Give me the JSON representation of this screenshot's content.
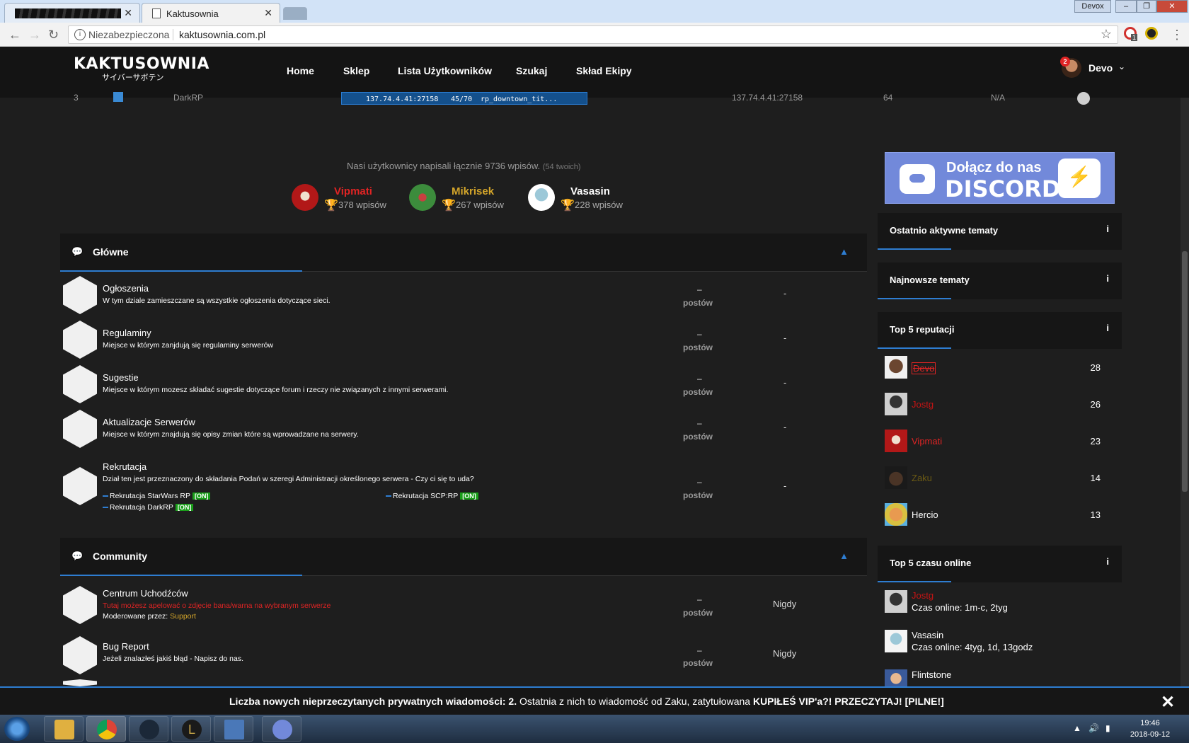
{
  "browser": {
    "tabs": [
      {
        "title": ""
      },
      {
        "title": "Kaktusownia"
      }
    ],
    "window_user": "Devox",
    "address": {
      "insecure_label": "Niezabezpieczona",
      "url": "kaktusownia.com.pl"
    },
    "ext_badge": "1"
  },
  "site": {
    "logo": {
      "name": "KAKTUSOWNIA",
      "sub": "サイバーサボテン"
    },
    "nav": [
      "Home",
      "Sklep",
      "Lista Użytkowników",
      "Szukaj",
      "Skład Ekipy"
    ],
    "user": {
      "name": "Devo",
      "notifications": "2"
    }
  },
  "server_row": {
    "rank": "3",
    "name": "DarkRP",
    "banner_address": "137.74.4.41:27158",
    "banner_players": "45/70",
    "banner_map": "rp_downtown_tit...",
    "address": "137.74.4.41:27158",
    "slots": "64",
    "status": "N/A"
  },
  "stats": {
    "line": "Nasi użytkownicy napisali łącznie 9736 wpisów.",
    "own": "(54 twoich)",
    "top_posters": [
      {
        "name": "Vipmati",
        "count": "378 wpisów",
        "color": "#e02424",
        "trophy_color": "#e0b020"
      },
      {
        "name": "Mikrisek",
        "count": "267 wpisów",
        "color": "#d4a52a",
        "trophy_color": "#bbbbbb"
      },
      {
        "name": "Vasasin",
        "count": "228 wpisów",
        "color": "#ffffff",
        "trophy_color": "#b0301c"
      }
    ]
  },
  "sections": [
    {
      "title": "Główne",
      "icon": "comments-icon",
      "forums": [
        {
          "name": "Ogłoszenia",
          "desc": "W tym dziale zamieszczane są wszystkie ogłoszenia dotyczące sieci.",
          "dash": "–",
          "posts": "postów",
          "last": "-"
        },
        {
          "name": "Regulaminy",
          "desc": "Miejsce w którym zanjdują się regulaminy serwerów",
          "dash": "–",
          "posts": "postów",
          "last": "-"
        },
        {
          "name": "Sugestie",
          "desc": "Miejsce w którym mozesz składać sugestie dotyczące forum i rzeczy nie związanych z innymi serwerami.",
          "dash": "–",
          "posts": "postów",
          "last": "-"
        },
        {
          "name": "Aktualizacje Serwerów",
          "desc": "Miejsce w którym znajdują się opisy zmian które są wprowadzane na serwery.",
          "dash": "–",
          "posts": "postów",
          "last": "-"
        },
        {
          "name": "Rekrutacja",
          "desc": "Dział ten jest przeznaczony do składania Podań w szeregi Administracji określonego serwera - Czy ci się to uda?",
          "dash": "–",
          "posts": "postów",
          "last": "-",
          "subforums": [
            {
              "name": "Rekrutacja StarWars RP",
              "tag": "[ON]"
            },
            {
              "name": "Rekrutacja SCP:RP",
              "tag": "[ON]"
            },
            {
              "name": "Rekrutacja DarkRP",
              "tag": "[ON]"
            }
          ]
        }
      ]
    },
    {
      "title": "Community",
      "icon": "comments-icon",
      "forums": [
        {
          "name": "Centrum Uchodźców",
          "desc": "Tutaj możesz apelować o zdjęcie bana/warna na wybranym serwerze",
          "desc_color": "#e02424",
          "moderated_label": "Moderowane przez:",
          "moderated_by": "Support",
          "dash": "–",
          "posts": "postów",
          "last": "Nigdy"
        },
        {
          "name": "Bug Report",
          "desc": "Jeżeli znalazłeś jakiś błąd - Napisz do nas.",
          "dash": "–",
          "posts": "postów",
          "last": "Nigdy"
        }
      ]
    }
  ],
  "sidebar": {
    "discord": {
      "join": "Dołącz do nas",
      "word": "DISCORD"
    },
    "panels": [
      {
        "title": "Ostatnio aktywne tematy",
        "info": "i"
      },
      {
        "title": "Najnowsze tematy",
        "info": "i"
      },
      {
        "title": "Top 5 reputacji",
        "info": "i"
      },
      {
        "title": "Top 5 czasu online",
        "info": "i"
      }
    ],
    "reputation": [
      {
        "name": "Devo",
        "value": "28",
        "color": "#e02424"
      },
      {
        "name": "Jostg",
        "value": "26",
        "color": "#c41414"
      },
      {
        "name": "Vipmati",
        "value": "23",
        "color": "#e02424"
      },
      {
        "name": "Zaku",
        "value": "14",
        "color": "#6b5a14"
      },
      {
        "name": "Hercio",
        "value": "13",
        "color": "#ffffff"
      }
    ],
    "online": [
      {
        "name": "Jostg",
        "time": "Czas online: 1m-c, 2tyg",
        "color": "#c41414"
      },
      {
        "name": "Vasasin",
        "time": "Czas online: 4tyg, 1d, 13godz",
        "color": "#ffffff"
      },
      {
        "name": "Flintstone",
        "time": "",
        "color": "#ffffff"
      }
    ]
  },
  "notification": {
    "prefix": "Liczba nowych nieprzeczytanych prywatnych wiadomości: 2.",
    "middle": " Ostatnia z nich to wiadomość od Zaku, zatytułowana ",
    "subject": "KUPIŁEŚ VIP'a?! PRZECZYTAJ! [PILNE!]",
    "close": "✕"
  },
  "taskbar": {
    "time": "19:46",
    "date": "2018-09-12"
  }
}
